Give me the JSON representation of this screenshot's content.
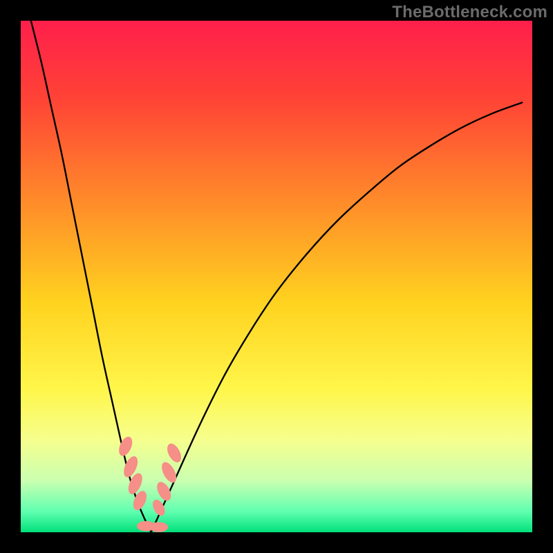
{
  "watermark": "TheBottleneck.com",
  "chart_data": {
    "type": "line",
    "title": "",
    "xlabel": "",
    "ylabel": "",
    "xlim": [
      0,
      1
    ],
    "ylim": [
      0,
      1
    ],
    "legend": false,
    "grid": false,
    "background_gradient_stops": [
      {
        "offset": 0.0,
        "color": "#ff1f4b"
      },
      {
        "offset": 0.15,
        "color": "#ff4236"
      },
      {
        "offset": 0.35,
        "color": "#ff8a2a"
      },
      {
        "offset": 0.55,
        "color": "#ffd21f"
      },
      {
        "offset": 0.72,
        "color": "#fff64a"
      },
      {
        "offset": 0.82,
        "color": "#f6ff8e"
      },
      {
        "offset": 0.9,
        "color": "#c9ffb0"
      },
      {
        "offset": 0.96,
        "color": "#5fffb0"
      },
      {
        "offset": 1.0,
        "color": "#00e07a"
      }
    ],
    "series": [
      {
        "name": "left-branch",
        "stroke": "#000000",
        "stroke_width": 2.4,
        "x": [
          0.02,
          0.04,
          0.06,
          0.08,
          0.1,
          0.12,
          0.14,
          0.16,
          0.18,
          0.2,
          0.215,
          0.23,
          0.245,
          0.255
        ],
        "y": [
          1.0,
          0.92,
          0.83,
          0.74,
          0.64,
          0.54,
          0.44,
          0.34,
          0.25,
          0.16,
          0.1,
          0.055,
          0.02,
          0.0
        ]
      },
      {
        "name": "right-branch",
        "stroke": "#000000",
        "stroke_width": 2.4,
        "x": [
          0.255,
          0.3,
          0.35,
          0.4,
          0.45,
          0.5,
          0.56,
          0.62,
          0.68,
          0.74,
          0.8,
          0.86,
          0.92,
          0.98
        ],
        "y": [
          0.0,
          0.1,
          0.21,
          0.31,
          0.395,
          0.47,
          0.545,
          0.61,
          0.665,
          0.715,
          0.755,
          0.79,
          0.818,
          0.84
        ]
      }
    ],
    "markers": [
      {
        "name": "left-dot-1",
        "cx": 0.205,
        "cy": 0.168,
        "rx": 0.011,
        "ry": 0.02,
        "rot": 24,
        "fill": "#f58f87"
      },
      {
        "name": "left-dot-2",
        "cx": 0.215,
        "cy": 0.128,
        "rx": 0.011,
        "ry": 0.022,
        "rot": 24,
        "fill": "#f58f87"
      },
      {
        "name": "left-dot-3",
        "cx": 0.224,
        "cy": 0.095,
        "rx": 0.011,
        "ry": 0.022,
        "rot": 24,
        "fill": "#f58f87"
      },
      {
        "name": "left-dot-4",
        "cx": 0.233,
        "cy": 0.062,
        "rx": 0.011,
        "ry": 0.02,
        "rot": 24,
        "fill": "#f58f87"
      },
      {
        "name": "right-dot-1",
        "cx": 0.3,
        "cy": 0.155,
        "rx": 0.011,
        "ry": 0.02,
        "rot": -28,
        "fill": "#f58f87"
      },
      {
        "name": "right-dot-2",
        "cx": 0.29,
        "cy": 0.117,
        "rx": 0.011,
        "ry": 0.022,
        "rot": -28,
        "fill": "#f58f87"
      },
      {
        "name": "right-dot-3",
        "cx": 0.28,
        "cy": 0.08,
        "rx": 0.011,
        "ry": 0.02,
        "rot": -28,
        "fill": "#f58f87"
      },
      {
        "name": "right-dot-4",
        "cx": 0.27,
        "cy": 0.048,
        "rx": 0.01,
        "ry": 0.017,
        "rot": -28,
        "fill": "#f58f87"
      },
      {
        "name": "bottom-dot-1",
        "cx": 0.245,
        "cy": 0.012,
        "rx": 0.018,
        "ry": 0.01,
        "rot": 0,
        "fill": "#f58f87"
      },
      {
        "name": "bottom-dot-2",
        "cx": 0.27,
        "cy": 0.01,
        "rx": 0.018,
        "ry": 0.01,
        "rot": 0,
        "fill": "#f58f87"
      }
    ]
  }
}
